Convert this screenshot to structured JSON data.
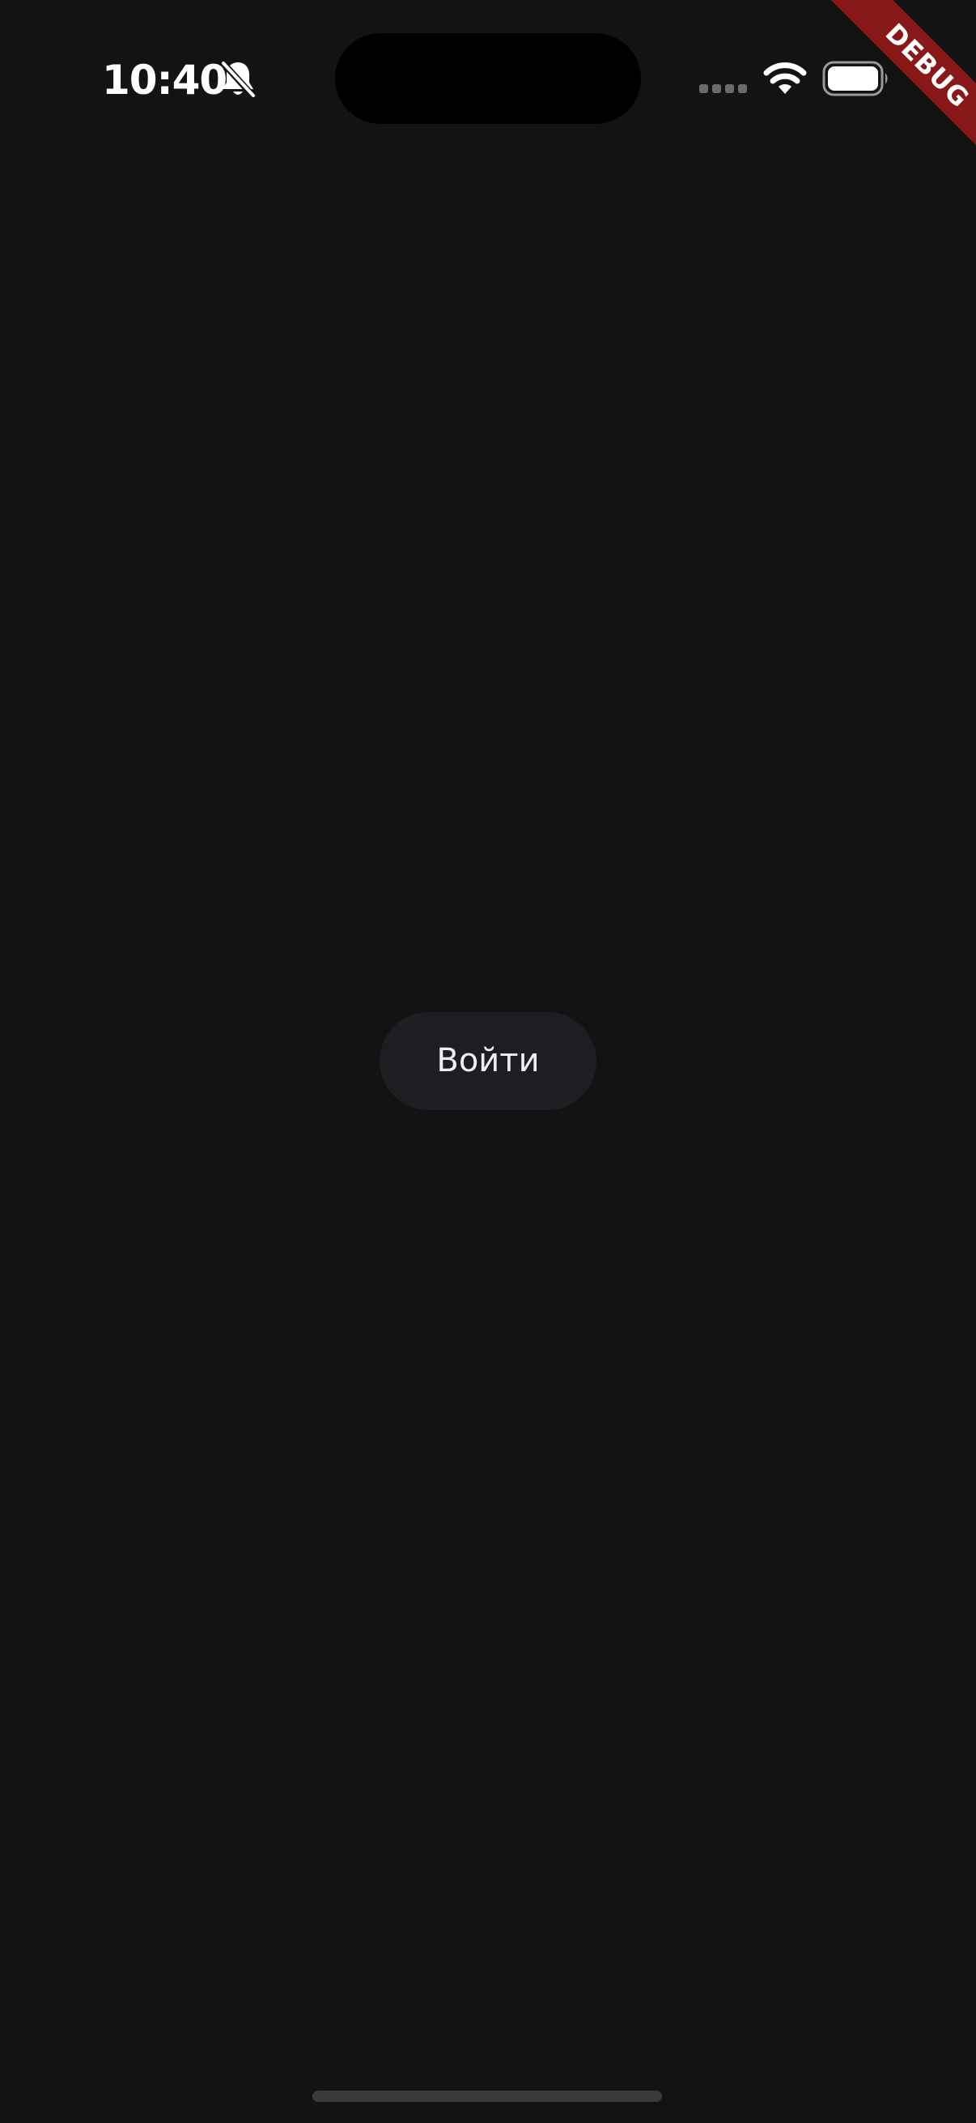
{
  "status_bar": {
    "time": "10:40",
    "icons": [
      "bell-slash-icon",
      "cellular-signal-icon",
      "wifi-icon",
      "battery-icon"
    ]
  },
  "debug_banner": {
    "label": "DEBUG",
    "color": "#891919"
  },
  "main": {
    "login_button_label": "Войти"
  },
  "colors": {
    "background": "#131313",
    "button_background": "#1f1d21",
    "button_text": "#f1eef3"
  }
}
